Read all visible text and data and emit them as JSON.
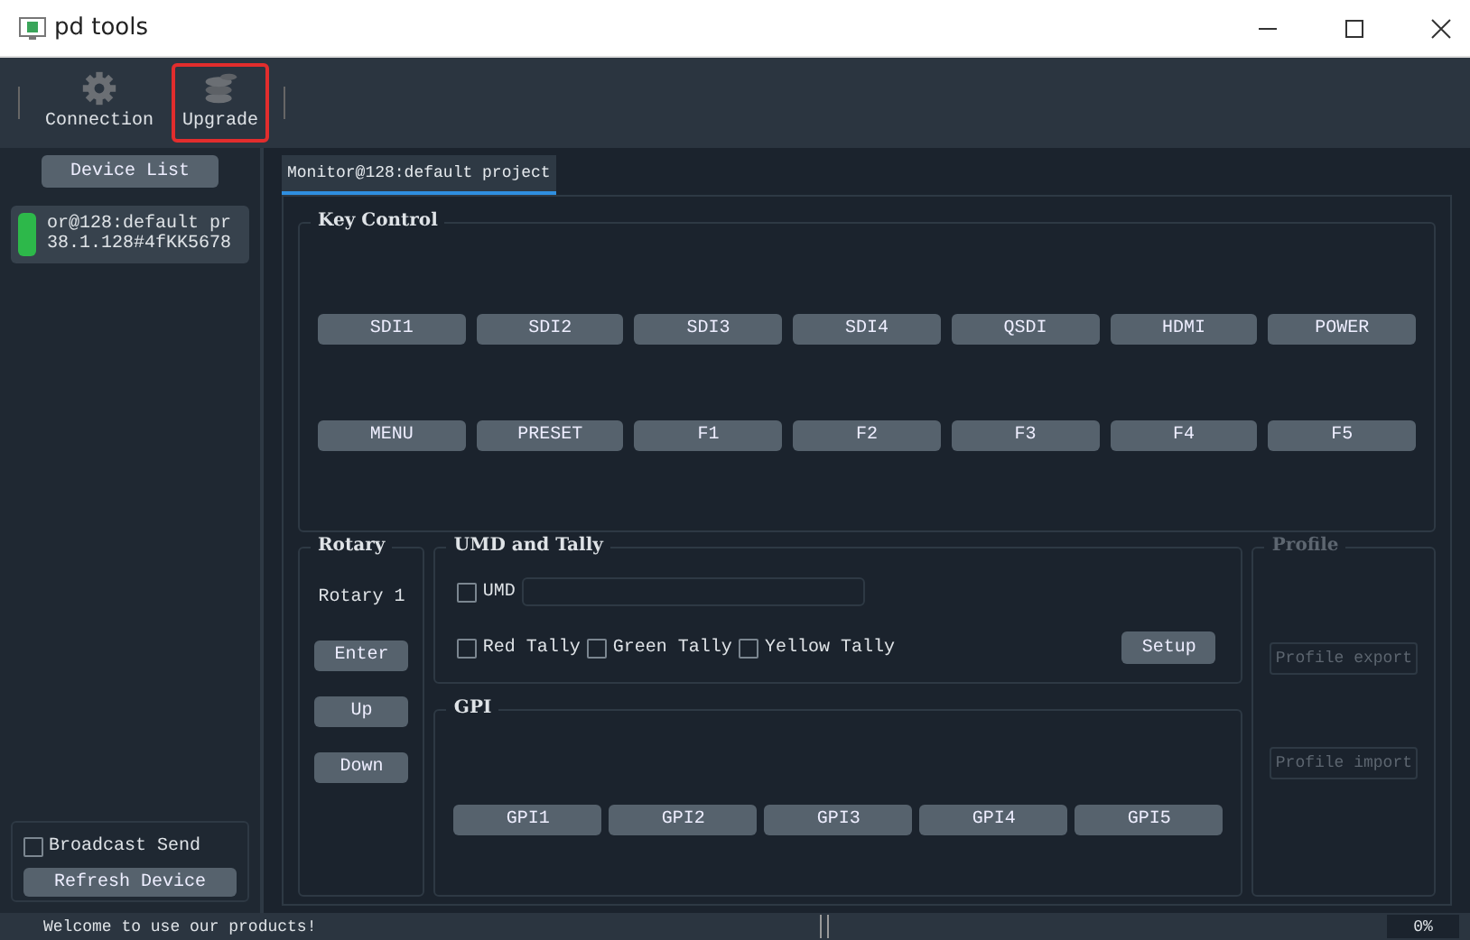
{
  "window": {
    "title": "pd tools"
  },
  "toolbar": [
    {
      "label": "Connection",
      "highlighted": false
    },
    {
      "label": "Upgrade",
      "highlighted": true
    }
  ],
  "sidebar": {
    "header_button": "Device List",
    "devices": [
      {
        "line1": "or@128:default pr",
        "line2": "38.1.128#4fKK5678",
        "color": "#2db84a"
      }
    ],
    "broadcast": {
      "label": "Broadcast Send",
      "checked": false
    },
    "refresh_button": "Refresh Device"
  },
  "tabs": [
    {
      "label": "Monitor@128:default project",
      "selected": true
    }
  ],
  "key_control": {
    "title": "Key Control",
    "rows": [
      [
        "SDI1",
        "SDI2",
        "SDI3",
        "SDI4",
        "QSDI",
        "HDMI",
        "POWER"
      ],
      [
        "MENU",
        "PRESET",
        "F1",
        "F2",
        "F3",
        "F4",
        "F5"
      ]
    ]
  },
  "rotary": {
    "title": "Rotary",
    "label": "Rotary 1",
    "buttons": [
      "Enter",
      "Up",
      "Down"
    ]
  },
  "umd_tally": {
    "title": "UMD and Tally",
    "umd": {
      "label": "UMD",
      "checked": false
    },
    "tallies": [
      {
        "label": "Red Tally",
        "checked": false
      },
      {
        "label": "Green Tally",
        "checked": false
      },
      {
        "label": "Yellow Tally",
        "checked": false
      }
    ],
    "setup_button": "Setup"
  },
  "gpi": {
    "title": "GPI",
    "buttons": [
      "GPI1",
      "GPI2",
      "GPI3",
      "GPI4",
      "GPI5"
    ]
  },
  "profile": {
    "title": "Profile",
    "disabled": true,
    "buttons": [
      "Profile export",
      "Profile import"
    ]
  },
  "status_bar": {
    "message": "Welcome to use our products!",
    "progress": {
      "level": 0,
      "reading": "0%"
    }
  }
}
